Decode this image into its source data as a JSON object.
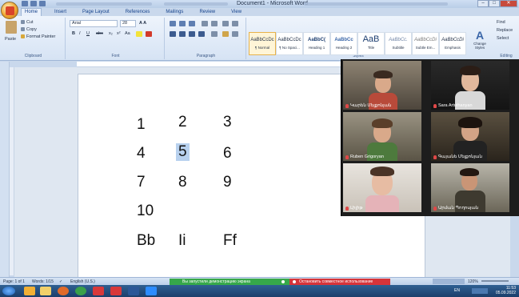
{
  "window": {
    "title": "Document1 - Microsoft Word"
  },
  "tabs": [
    "Home",
    "Insert",
    "Page Layout",
    "References",
    "Mailings",
    "Review",
    "View"
  ],
  "clipboard": {
    "paste": "Paste",
    "cut": "Cut",
    "copy": "Copy",
    "format_painter": "Format Painter",
    "label": "Clipboard"
  },
  "font": {
    "name": "Arial",
    "size": "28",
    "label": "Font",
    "bold": "B",
    "italic": "I",
    "underline": "U"
  },
  "paragraph": {
    "label": "Paragraph"
  },
  "styles": {
    "label": "Styles",
    "items": [
      {
        "sample": "AaBbCcDc",
        "name": "¶ Normal"
      },
      {
        "sample": "AaBbCcDc",
        "name": "¶ No Spaci..."
      },
      {
        "sample": "AaBbC(",
        "name": "Heading 1"
      },
      {
        "sample": "AaBbCc",
        "name": "Heading 2"
      },
      {
        "sample": "AaB",
        "name": "Title"
      },
      {
        "sample": "AaBbCc.",
        "name": "Subtitle"
      },
      {
        "sample": "AaBbCcDi",
        "name": "Subtle Em..."
      },
      {
        "sample": "AaBbCcDi",
        "name": "Emphasis"
      }
    ],
    "change": "Change Styles"
  },
  "editing": {
    "find": "Find",
    "replace": "Replace",
    "select": "Select",
    "label": "Editing"
  },
  "document": {
    "rows": [
      [
        "1",
        "2",
        "3"
      ],
      [
        "4",
        "5",
        "6"
      ],
      [
        "7",
        "8",
        "9"
      ],
      [
        "10",
        "",
        ""
      ],
      [
        "Bb",
        "Ii",
        "Ff"
      ]
    ]
  },
  "participants": [
    {
      "name": "Կարեն Մելքոնյան",
      "color": "#7b4a3a"
    },
    {
      "name": "Sara Artuthanyan",
      "color": "#5e5e5e"
    },
    {
      "name": "Ruben Grigoryan",
      "color": "#8a7a60"
    },
    {
      "name": "Գայանե Մելքոնյան",
      "color": "#4a3b30"
    },
    {
      "name": "Լիլիթ",
      "color": "#c98a6a"
    },
    {
      "name": "Արման Պողոսյան",
      "color": "#5b5040"
    }
  ],
  "status": {
    "page": "Page: 1 of 1",
    "words": "Words: 1/15",
    "language": "English (U.S.)",
    "share_note": "Вы запустили демонстрацию экрана",
    "stop_share": "Остановить совместное использование",
    "zoom": "120%"
  },
  "taskbar": {
    "lang": "EN",
    "time": "11:53",
    "date": "05.09.2022"
  }
}
